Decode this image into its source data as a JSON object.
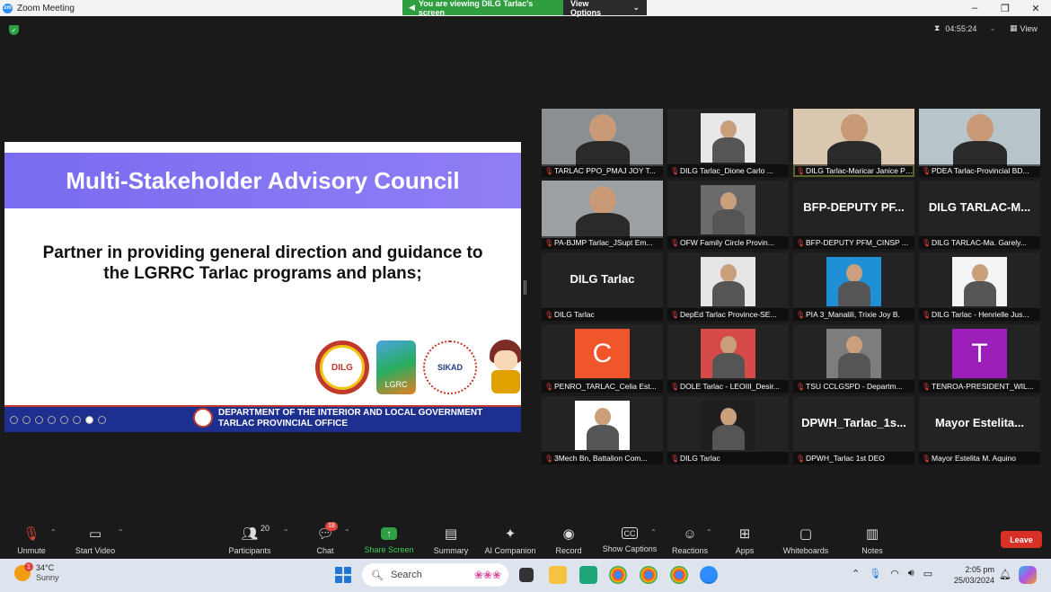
{
  "window": {
    "title": "Zoom Meeting",
    "share_banner": "You are viewing DILG Tarlac's screen",
    "view_options": "View Options"
  },
  "meeting": {
    "timer": "04:55:24",
    "view_label": "View"
  },
  "slide": {
    "title": "Multi-Stakeholder Advisory Council",
    "body": "Partner in providing general direction and guidance to the LGRRC Tarlac programs and plans;",
    "footer_line1": "DEPARTMENT OF THE INTERIOR AND LOCAL GOVERNMENT",
    "footer_line2": "TARLAC PROVINCIAL OFFICE",
    "logo_dilg": "DILG",
    "logo_lgrc": "LGRC",
    "logo_sikad": "SIKAD"
  },
  "participants": [
    {
      "name": "TARLAC PPO_PMAJ JOY T...",
      "kind": "photo",
      "bg": "#8a8f94"
    },
    {
      "name": "DILG Tarlac_Dione Carlo ...",
      "kind": "thumb",
      "bg": "#e8e8e8"
    },
    {
      "name": "DILG Tarlac-Maricar Janice Pe...",
      "kind": "photo",
      "bg": "#d9c7b0",
      "speaking": true
    },
    {
      "name": "PDEA Tarlac-Provincial BD...",
      "kind": "photo",
      "bg": "#b7c4c9"
    },
    {
      "name": "PA-BJMP Tarlac_JSupt Em...",
      "kind": "photo",
      "bg": "#9aa0a4"
    },
    {
      "name": "OFW Family Circle Provin...",
      "kind": "thumb",
      "bg": "#6b6b6b"
    },
    {
      "name": "BFP-DEPUTY PFM_CINSP ...",
      "kind": "text",
      "text": "BFP-DEPUTY PF..."
    },
    {
      "name": "DILG TARLAC-Ma. Garely...",
      "kind": "text",
      "text": "DILG TARLAC-M..."
    },
    {
      "name": "DILG Tarlac",
      "kind": "text",
      "text": "DILG Tarlac"
    },
    {
      "name": "DepEd Tarlac Province-SE...",
      "kind": "thumb",
      "bg": "#e6e6e6"
    },
    {
      "name": "PIA 3_Manalili, Trixie Joy B.",
      "kind": "thumb",
      "bg": "#1f8fd6"
    },
    {
      "name": "DILG Tarlac - Henrielle Jus...",
      "kind": "thumb",
      "bg": "#f4f4f4"
    },
    {
      "name": "PENRO_TARLAC_Celia Est...",
      "kind": "initial",
      "text": "C",
      "bg": "#f0562a"
    },
    {
      "name": "DOLE Tarlac - LEOIII_Desir...",
      "kind": "thumb",
      "bg": "#d64a4a"
    },
    {
      "name": "TSU CCLGSPD - Departm...",
      "kind": "thumb",
      "bg": "#7d7d7d"
    },
    {
      "name": "TENROA-PRESIDENT_WIL...",
      "kind": "initial",
      "text": "T",
      "bg": "#9b1fb8"
    },
    {
      "name": "3Mech Bn, Battalion Com...",
      "kind": "thumb",
      "bg": "#ffffff"
    },
    {
      "name": "DILG Tarlac",
      "kind": "thumb",
      "bg": "#1f1f1f"
    },
    {
      "name": "DPWH_Tarlac 1st DEO",
      "kind": "text",
      "text": "DPWH_Tarlac_1s..."
    },
    {
      "name": "Mayor Estelita M. Aquino",
      "kind": "text",
      "text": "Mayor Estelita..."
    }
  ],
  "toolbar": {
    "unmute": "Unmute",
    "start_video": "Start Video",
    "participants": "Participants",
    "participants_count": "20",
    "chat": "Chat",
    "chat_badge": "18",
    "share_screen": "Share Screen",
    "summary": "Summary",
    "ai_companion": "AI Companion",
    "record": "Record",
    "show_captions": "Show Captions",
    "reactions": "Reactions",
    "apps": "Apps",
    "whiteboards": "Whiteboards",
    "notes": "Notes",
    "leave": "Leave"
  },
  "taskbar": {
    "weather_temp": "34°C",
    "weather_cond": "Sunny",
    "weather_badge": "1",
    "search_placeholder": "Search",
    "time": "2:05 pm",
    "date": "25/03/2024"
  },
  "colors": {
    "accent_green": "#2ea043",
    "leave_red": "#d93025",
    "slide_header": "#7a6cf0",
    "slide_footer": "#1d2f8f",
    "speaking_outline": "#c6e05a"
  }
}
